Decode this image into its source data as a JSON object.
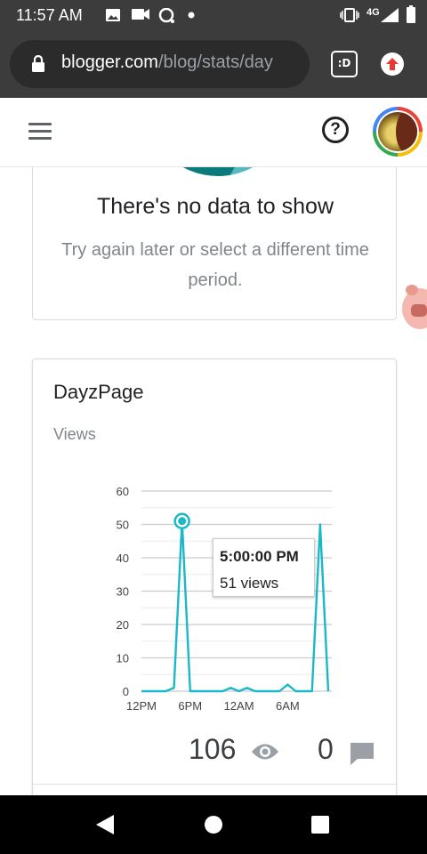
{
  "status_bar": {
    "time": "11:57 AM",
    "network_label": "4G",
    "icons": [
      "gallery-icon",
      "video-icon",
      "chat-icon",
      "dot-icon",
      "vibrate-icon",
      "signal-icon",
      "battery-icon"
    ]
  },
  "browser": {
    "url_host": "blogger.com",
    "url_path": "/blog/stats/day",
    "tab_switcher_label": ":D"
  },
  "header": {
    "help_symbol": "?"
  },
  "empty_card": {
    "title": "There's no data to show",
    "subtitle": "Try again later or select a different time period."
  },
  "stats_card": {
    "title": "DayzPage",
    "metric_label": "Views",
    "tooltip": {
      "time": "5:00:00 PM",
      "views": "51 views"
    },
    "views_total": "106",
    "comments_total": "0"
  },
  "colors": {
    "status_bar_bg": "#3c3c3c",
    "line_color": "#1ab8c8",
    "text_primary": "#202124",
    "text_secondary": "#80868b"
  },
  "chart_data": {
    "type": "line",
    "y_ticks": [
      "0",
      "10",
      "20",
      "30",
      "40",
      "50",
      "60"
    ],
    "x_ticks": [
      "12PM",
      "6PM",
      "12AM",
      "6AM"
    ],
    "ylim": [
      0,
      60
    ],
    "grid": true,
    "series": [
      {
        "values": [
          0,
          0,
          0,
          0,
          1,
          51,
          0,
          0,
          0,
          0,
          0,
          1,
          0,
          1,
          0,
          0,
          0,
          0,
          2,
          0,
          0,
          0,
          50,
          0
        ]
      }
    ],
    "highlight_index": 5
  }
}
